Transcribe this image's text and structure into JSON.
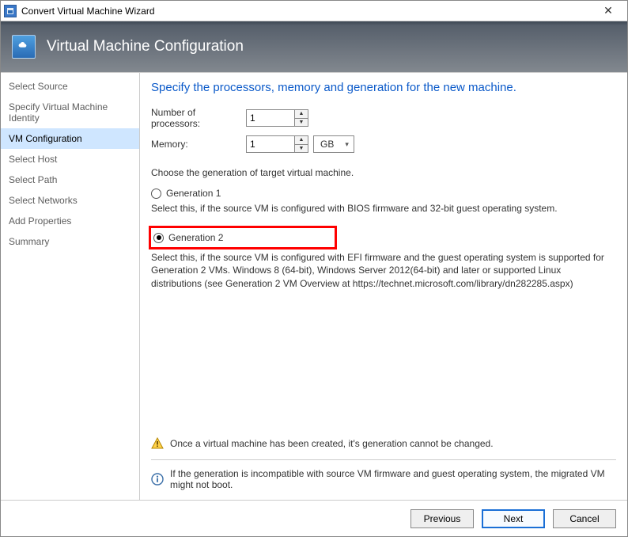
{
  "window": {
    "title": "Convert Virtual Machine Wizard"
  },
  "banner": {
    "title": "Virtual Machine Configuration"
  },
  "sidebar": {
    "items": [
      {
        "label": "Select Source"
      },
      {
        "label": "Specify Virtual Machine Identity"
      },
      {
        "label": "VM Configuration"
      },
      {
        "label": "Select Host"
      },
      {
        "label": "Select Path"
      },
      {
        "label": "Select Networks"
      },
      {
        "label": "Add Properties"
      },
      {
        "label": "Summary"
      }
    ],
    "active_index": 2
  },
  "main": {
    "heading": "Specify the processors, memory and generation for the new machine.",
    "proc_label": "Number of processors:",
    "proc_value": "1",
    "mem_label": "Memory:",
    "mem_value": "1",
    "mem_unit": "GB",
    "gen_prompt": "Choose the generation of target virtual machine.",
    "gen1_label": "Generation 1",
    "gen1_desc": "Select this, if the source VM is configured with BIOS firmware and 32-bit guest operating system.",
    "gen2_label": "Generation 2",
    "gen2_desc": "Select this, if the source VM is configured with EFI firmware and the guest operating system is supported for Generation 2 VMs. Windows 8 (64-bit), Windows Server 2012(64-bit) and later or supported Linux distributions (see Generation 2 VM Overview at https://technet.microsoft.com/library/dn282285.aspx)",
    "selected_generation": "gen2",
    "warn_text": "Once a virtual machine has been created, it's generation cannot be changed.",
    "info_text": "If the generation is incompatible with source VM firmware and guest operating system, the migrated VM might not boot."
  },
  "buttons": {
    "previous": "Previous",
    "next": "Next",
    "cancel": "Cancel"
  }
}
